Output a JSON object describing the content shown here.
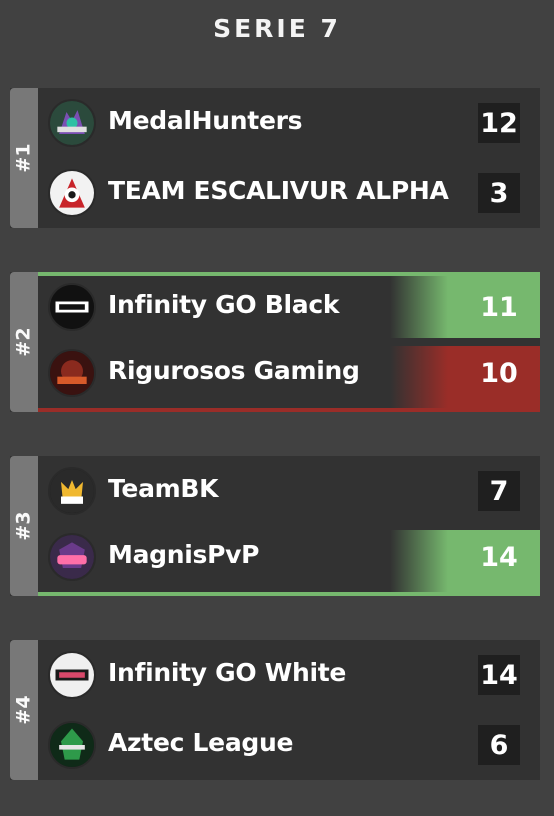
{
  "title": "SERIE 7",
  "matches": [
    {
      "seed": "#1",
      "teams": [
        {
          "name": "MedalHunters",
          "score": "12",
          "result": "none"
        },
        {
          "name": "TEAM ESCALIVUR ALPHA",
          "score": "3",
          "result": "none"
        }
      ]
    },
    {
      "seed": "#2",
      "teams": [
        {
          "name": "Infinity GO Black",
          "score": "11",
          "result": "win"
        },
        {
          "name": "Rigurosos Gaming",
          "score": "10",
          "result": "lose"
        }
      ]
    },
    {
      "seed": "#3",
      "teams": [
        {
          "name": "TeamBK",
          "score": "7",
          "result": "none"
        },
        {
          "name": "MagnisPvP",
          "score": "14",
          "result": "win"
        }
      ]
    },
    {
      "seed": "#4",
      "teams": [
        {
          "name": "Infinity GO White",
          "score": "14",
          "result": "none"
        },
        {
          "name": "Aztec League",
          "score": "6",
          "result": "none"
        }
      ]
    }
  ],
  "colors": {
    "win": "#76b86e",
    "lose": "#9a2d28",
    "background": "#414141",
    "panel": "#323232"
  }
}
